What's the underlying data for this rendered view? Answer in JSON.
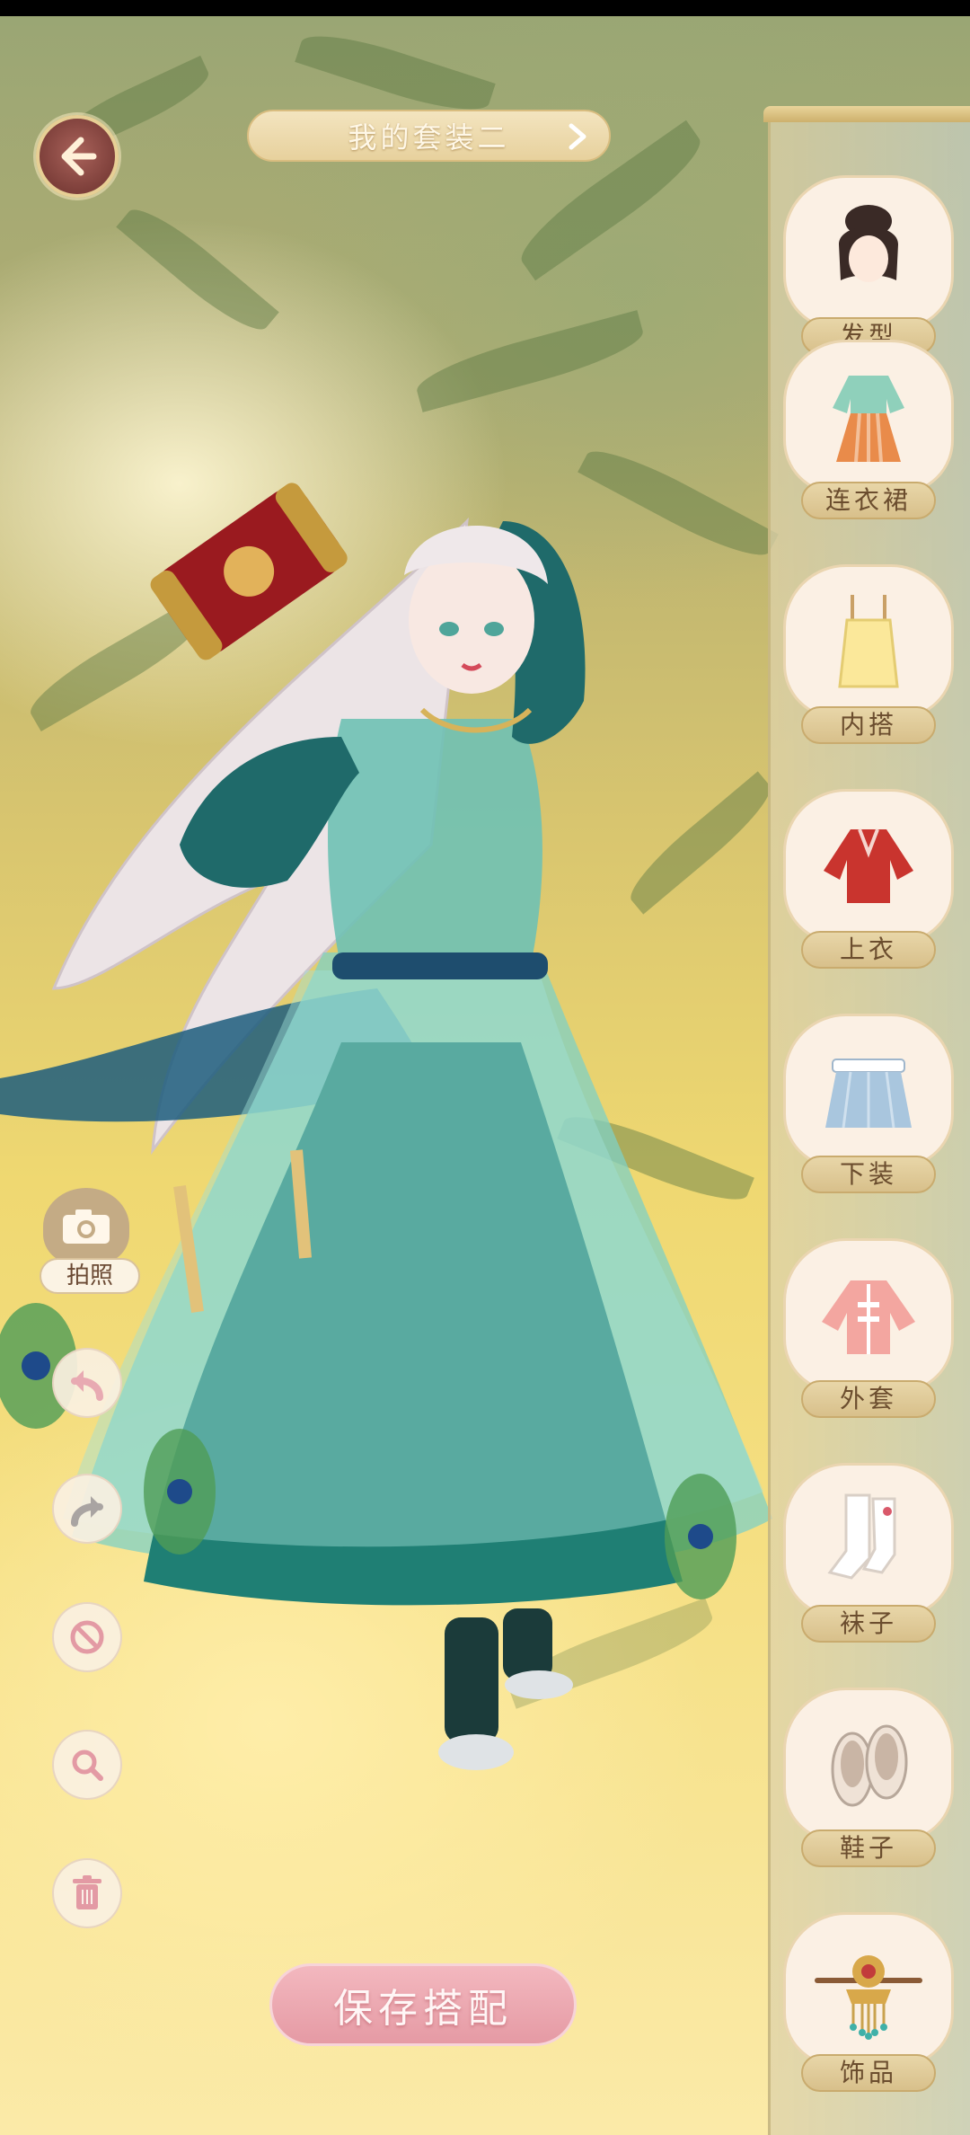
{
  "header": {
    "outfit_name": "我的套装二"
  },
  "left_tools": {
    "camera_label": "拍照"
  },
  "footer": {
    "save_label": "保存搭配"
  },
  "categories": [
    {
      "label": "发型",
      "icon": "hairstyle-icon"
    },
    {
      "label": "连衣裙",
      "icon": "dress-icon"
    },
    {
      "label": "内搭",
      "icon": "inner-top-icon"
    },
    {
      "label": "上衣",
      "icon": "jacket-top-icon"
    },
    {
      "label": "下装",
      "icon": "skirt-icon"
    },
    {
      "label": "外套",
      "icon": "coat-icon"
    },
    {
      "label": "袜子",
      "icon": "socks-icon"
    },
    {
      "label": "鞋子",
      "icon": "shoes-icon"
    },
    {
      "label": "饰品",
      "icon": "accessory-icon"
    }
  ],
  "colors": {
    "panel_label": "#d8c08b",
    "save_button": "#e59aa4",
    "back_button": "#7d3f3a",
    "dress_teal": "#3a9e8e",
    "sleeve_dark_teal": "#1f6a6a"
  }
}
